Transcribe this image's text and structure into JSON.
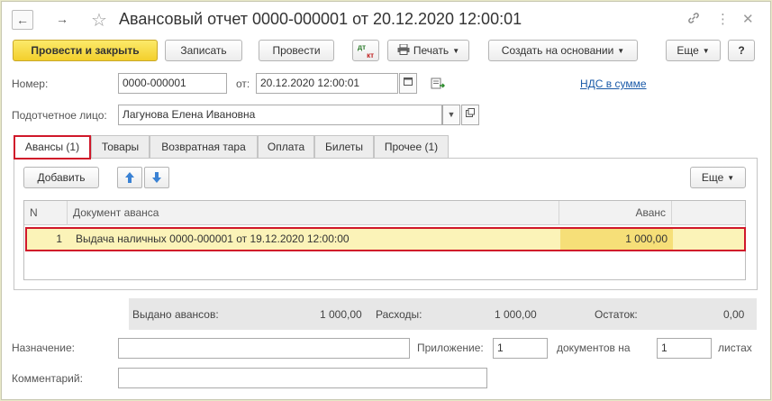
{
  "window": {
    "title": "Авансовый отчет 0000-000001 от 20.12.2020 12:00:01",
    "nav_back": "←",
    "nav_forward": "→"
  },
  "toolbar": {
    "post_close_label": "Провести и закрыть",
    "save_label": "Записать",
    "post_label": "Провести",
    "dt_kt_top": "дт",
    "dt_kt_bottom": "кт",
    "print_label": "Печать",
    "create_based_label": "Создать на основании",
    "more_label": "Еще",
    "help_label": "?"
  },
  "form": {
    "number_label": "Номер:",
    "number_value": "0000-000001",
    "date_label": "от:",
    "date_value": "20.12.2020 12:00:01",
    "vat_link": "НДС в сумме",
    "person_label": "Подотчетное лицо:",
    "person_value": "Лагунова Елена Ивановна"
  },
  "tabs": [
    {
      "label": "Авансы (1)",
      "active": true
    },
    {
      "label": "Товары"
    },
    {
      "label": "Возвратная тара"
    },
    {
      "label": "Оплата"
    },
    {
      "label": "Билеты"
    },
    {
      "label": "Прочее (1)"
    }
  ],
  "panel": {
    "add_label": "Добавить",
    "more_label": "Еще"
  },
  "table": {
    "columns": [
      "N",
      "Документ аванса",
      "Аванс"
    ],
    "rows": [
      {
        "n": "1",
        "document": "Выдача наличных 0000-000001 от 19.12.2020 12:00:00",
        "amount": "1 000,00"
      }
    ]
  },
  "summary": {
    "issued_label": "Выдано авансов:",
    "issued_value": "1 000,00",
    "expenses_label": "Расходы:",
    "expenses_value": "1 000,00",
    "balance_label": "Остаток:",
    "balance_value": "0,00"
  },
  "footer": {
    "purpose_label": "Назначение:",
    "purpose_value": "",
    "attachment_label": "Приложение:",
    "attachment_value": "1",
    "documents_label": "документов на",
    "sheets_value": "1",
    "sheets_label": "листах",
    "comment_label": "Комментарий:",
    "comment_value": ""
  },
  "colors": {
    "primary_button": "#f3cf2c",
    "highlight_border": "#d0182a",
    "link": "#1a5aa8",
    "selected_row": "#fbf3b8"
  }
}
